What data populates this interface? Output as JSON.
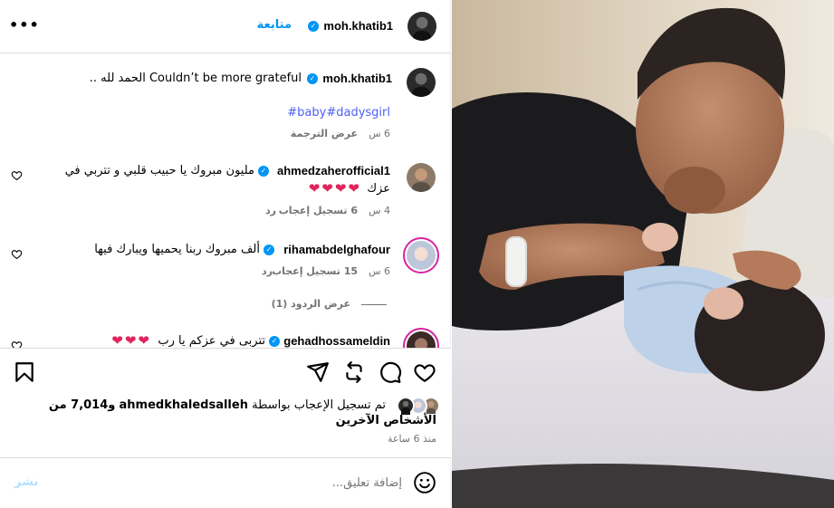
{
  "header": {
    "username": "moh.khatib1",
    "follow_label": "متابعة",
    "more_icon": "more-horizontal-icon"
  },
  "caption": {
    "username": "moh.khatib1",
    "text": "Couldn’t be more grateful الحمد لله ..",
    "hashtags": "#baby#dadysgirl",
    "time": "6 س",
    "translate_label": "عرض الترجمة"
  },
  "comments": [
    {
      "username": "ahmedzaherofficial1",
      "text_line1": "مليون مبروك يا حبيب قلبي و تتربي في",
      "text_line2": "عزك",
      "emoji_hearts": "❤❤❤❤",
      "time": "4 س",
      "likes": "6 تسجيل إعجاب",
      "reply": "رد"
    },
    {
      "username": "rihamabdelghafour",
      "text": "ألف مبروك ربنا يحميها ويبارك فيها",
      "time": "6 س",
      "likes": "15 تسجيل إعجاب",
      "reply": "رد",
      "view_replies": "عرض الردود (1)"
    },
    {
      "username": "gehadhossameldin",
      "text": "تتربى في عزكم يا رب",
      "emoji_hearts": "❤❤❤"
    }
  ],
  "likes_summary": {
    "prefix": "تم تسجيل الإعجاب بواسطة",
    "user": "ahmedkhaledsalleh",
    "count_text": "و7,014 من الأشخاص الآخرين",
    "time": "منذ 6 ساعة"
  },
  "comment_box": {
    "placeholder": "إضافة تعليق...",
    "post_label": "نشر",
    "emoji_icon": "emoji-icon"
  },
  "colors": {
    "accent": "#0095f6",
    "link": "#4d5ff5",
    "heart": "#e0245e",
    "muted": "#737373"
  }
}
